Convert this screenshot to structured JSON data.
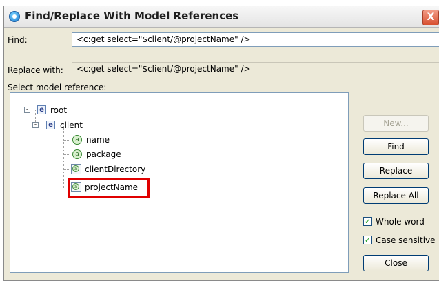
{
  "window": {
    "title": "Find/Replace With Model References",
    "close_glyph": "X"
  },
  "find": {
    "label": "Find:",
    "value": "<c:get select=\"$client/@projectName\" />"
  },
  "replace": {
    "label": "Replace with:",
    "value": "<c:get select=\"$client/@projectName\" />"
  },
  "tree": {
    "heading": "Select model reference:",
    "root": {
      "label": "root",
      "icon": "e",
      "expander": "-"
    },
    "client": {
      "label": "client",
      "icon": "e",
      "expander": "-"
    },
    "attributes": [
      {
        "label": "name",
        "icon": "a"
      },
      {
        "label": "package",
        "icon": "a"
      },
      {
        "label": "clientDirectory",
        "icon": "a-list"
      },
      {
        "label": "projectName",
        "icon": "a-list",
        "highlighted": true
      }
    ]
  },
  "buttons": {
    "new": "New...",
    "find": "Find",
    "replace": "Replace",
    "replace_all": "Replace All",
    "close": "Close"
  },
  "options": {
    "whole_word": {
      "label": "Whole word",
      "checked": true
    },
    "case_sensitive": {
      "label": "Case sensitive",
      "checked": true
    }
  },
  "colors": {
    "highlight": "#e00000",
    "dialog_bg": "#ece9d8",
    "field_border": "#7f9db9"
  }
}
